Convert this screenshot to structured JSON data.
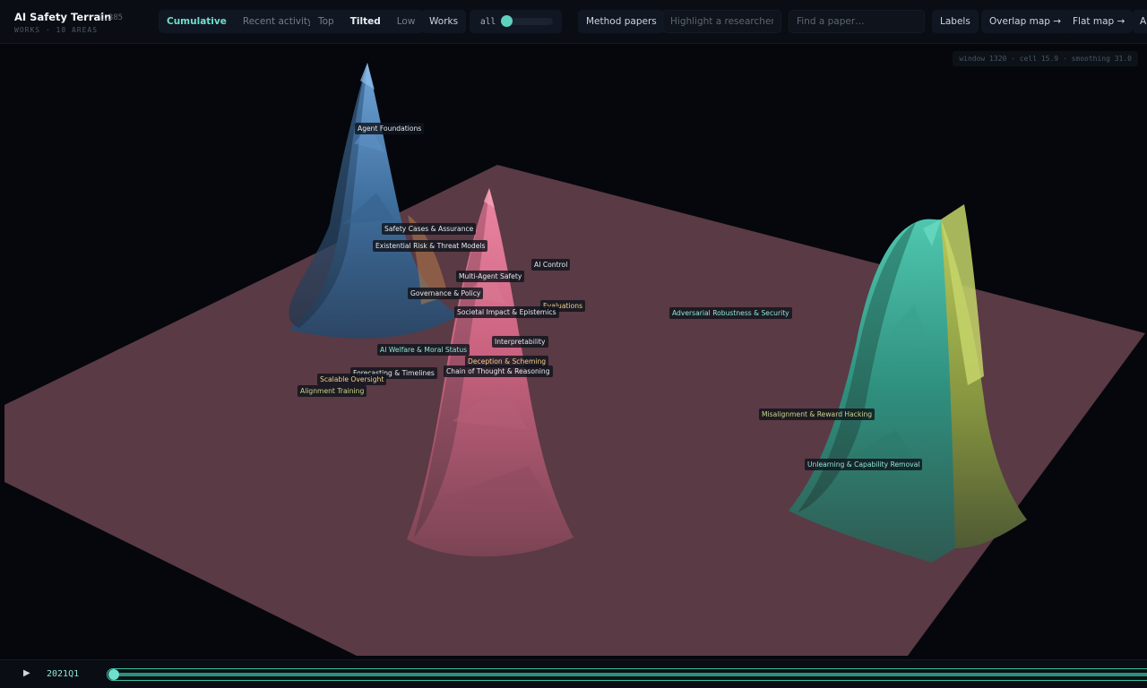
{
  "app": {
    "title": "AI Safety Terrain",
    "count": "1,385",
    "subtitle": "WORKS · 18 AREAS"
  },
  "toolbar": {
    "time_modes": [
      "Cumulative",
      "Recent activity"
    ],
    "time_mode_selected": "Cumulative",
    "views": [
      "Top",
      "Tilted",
      "Low"
    ],
    "view_selected": "Tilted",
    "works_label": "Works",
    "slider_label": "all",
    "method_papers_label": "Method papers",
    "researcher_placeholder": "Highlight a researcher…",
    "paper_placeholder": "Find a paper…",
    "labels_label": "Labels",
    "overlap_map_label": "Overlap map →",
    "flat_map_label": "Flat map →",
    "cut_label": "A"
  },
  "status": "window 1320 · cell 15.9 · smoothing 31.0",
  "areas": [
    {
      "name": "Agent Foundations",
      "color": "white"
    },
    {
      "name": "Safety Cases & Assurance",
      "color": "white"
    },
    {
      "name": "Existential Risk & Threat Models",
      "color": "white"
    },
    {
      "name": "AI Control",
      "color": "white"
    },
    {
      "name": "Multi-Agent Safety",
      "color": "white"
    },
    {
      "name": "Governance & Policy",
      "color": "white"
    },
    {
      "name": "Evaluations",
      "color": "yellow"
    },
    {
      "name": "Societal Impact & Epistemics",
      "color": "white"
    },
    {
      "name": "Adversarial Robustness & Security",
      "color": "teal"
    },
    {
      "name": "AI Welfare & Moral Status",
      "color": "teal"
    },
    {
      "name": "Interpretability",
      "color": "white"
    },
    {
      "name": "Deception & Scheming",
      "color": "yellow"
    },
    {
      "name": "Chain of Thought & Reasoning",
      "color": "white"
    },
    {
      "name": "Forecasting & Timelines",
      "color": "white"
    },
    {
      "name": "Scalable Oversight",
      "color": "yellow"
    },
    {
      "name": "Alignment Training",
      "color": "green"
    },
    {
      "name": "Misalignment & Reward Hacking",
      "color": "green"
    },
    {
      "name": "Unlearning & Capability Removal",
      "color": "teal"
    }
  ],
  "colors": {
    "background": "#05070c",
    "plane": "#5a3a44",
    "peak_blue": "#4f86b8",
    "peak_pink": "#d9708c",
    "peak_teal": "#3ea892",
    "peak_olive": "#a9b850",
    "accent": "#6fe0cb"
  },
  "playback": {
    "play_icon": "play-icon",
    "period": "2021Q1"
  }
}
